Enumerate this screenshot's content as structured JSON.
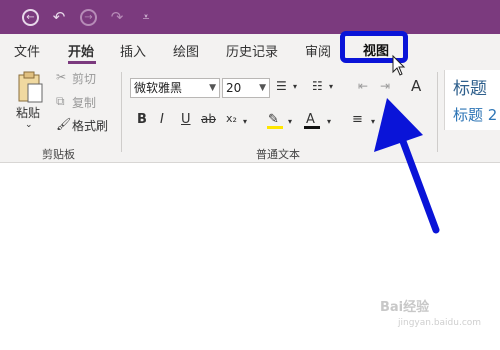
{
  "quick_access": {
    "icons": [
      "back-icon",
      "undo-icon",
      "forward-icon",
      "redo-icon",
      "customize-icon"
    ]
  },
  "tabs": [
    {
      "label": "文件"
    },
    {
      "label": "开始"
    },
    {
      "label": "插入"
    },
    {
      "label": "绘图"
    },
    {
      "label": "历史记录"
    },
    {
      "label": "审阅"
    },
    {
      "label": "视图"
    }
  ],
  "ribbon": {
    "clipboard": {
      "paste": "粘贴",
      "cut": "剪切",
      "copy": "复制",
      "format_painter": "格式刷",
      "group_label": "剪贴板"
    },
    "basic_text": {
      "font": "微软雅黑",
      "size": "20",
      "group_label": "普通文本"
    },
    "styles": {
      "heading1": "标题",
      "heading2": "标题 2"
    }
  },
  "colors": {
    "titlebar": "#7b3a7e",
    "ribbon": "#f3f2f1",
    "highlight_box": "#0a14d8",
    "arrow": "#0a14d8"
  },
  "watermark": {
    "line1": "Bai经验",
    "line2": "jingyan.baidu.com"
  }
}
